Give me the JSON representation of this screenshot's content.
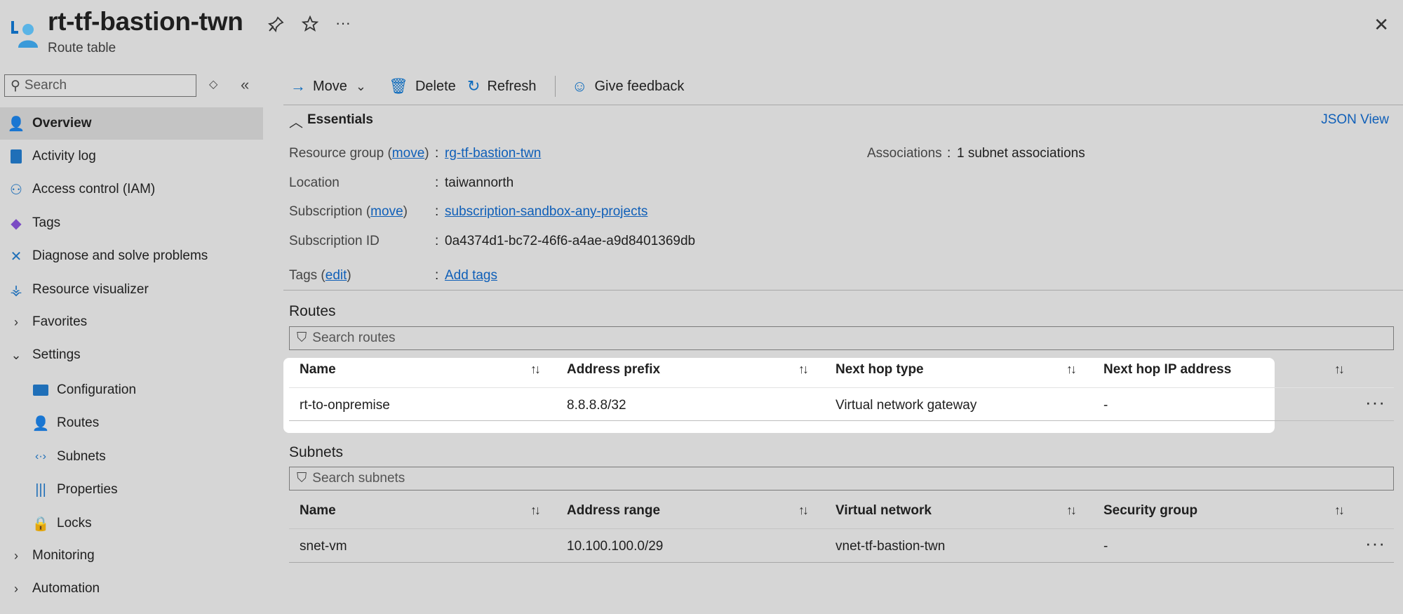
{
  "header": {
    "title": "rt-tf-bastion-twn",
    "subtitle": "Route table",
    "pin_icon": "pin-icon",
    "star_icon": "star-icon",
    "more_label": "···",
    "close_label": "✕"
  },
  "sidebar": {
    "search_placeholder": "Search",
    "items": [
      {
        "label": "Overview",
        "icon": "overview-icon"
      },
      {
        "label": "Activity log",
        "icon": "activity-log-icon"
      },
      {
        "label": "Access control (IAM)",
        "icon": "iam-icon"
      },
      {
        "label": "Tags",
        "icon": "tag-icon"
      },
      {
        "label": "Diagnose and solve problems",
        "icon": "wrench-icon"
      },
      {
        "label": "Resource visualizer",
        "icon": "visualizer-icon"
      },
      {
        "label": "Favorites",
        "icon": "chevron-right-icon"
      },
      {
        "label": "Settings",
        "icon": "chevron-down-icon"
      },
      {
        "label": "Configuration",
        "icon": "configuration-icon"
      },
      {
        "label": "Routes",
        "icon": "routes-icon"
      },
      {
        "label": "Subnets",
        "icon": "subnets-icon"
      },
      {
        "label": "Properties",
        "icon": "properties-icon"
      },
      {
        "label": "Locks",
        "icon": "lock-icon"
      },
      {
        "label": "Monitoring",
        "icon": "chevron-right-icon"
      },
      {
        "label": "Automation",
        "icon": "chevron-right-icon"
      }
    ]
  },
  "toolbar": {
    "move": "Move",
    "delete": "Delete",
    "refresh": "Refresh",
    "feedback": "Give feedback"
  },
  "essentials": {
    "title": "Essentials",
    "json_view": "JSON View",
    "resource_group_label": "Resource group (",
    "move_link": "move",
    "resource_group_value": "rg-tf-bastion-twn",
    "location_label": "Location",
    "location_value": "taiwannorth",
    "subscription_label": "Subscription (",
    "subscription_value": "subscription-sandbox-any-projects",
    "subscription_id_label": "Subscription ID",
    "subscription_id_value": "0a4374d1-bc72-46f6-a4ae-a9d8401369db",
    "tags_label": "Tags (",
    "edit_link": "edit",
    "tags_value": "Add tags",
    "associations_label": "Associations",
    "associations_value": "1 subnet associations",
    "colon": ":",
    "close_paren": ")"
  },
  "routes": {
    "title": "Routes",
    "search_placeholder": "Search routes",
    "columns": [
      "Name",
      "Address prefix",
      "Next hop type",
      "Next hop IP address"
    ],
    "rows": [
      [
        "rt-to-onpremise",
        "8.8.8.8/32",
        "Virtual network gateway",
        "-"
      ]
    ]
  },
  "subnets": {
    "title": "Subnets",
    "search_placeholder": "Search subnets",
    "columns": [
      "Name",
      "Address range",
      "Virtual network",
      "Security group"
    ],
    "rows": [
      [
        "snet-vm",
        "10.100.100.0/29",
        "vnet-tf-bastion-twn",
        "-"
      ]
    ]
  },
  "colors": {
    "accent": "#0f6cbd",
    "link": "#0f5fb8",
    "background": "#d6d6d6"
  }
}
